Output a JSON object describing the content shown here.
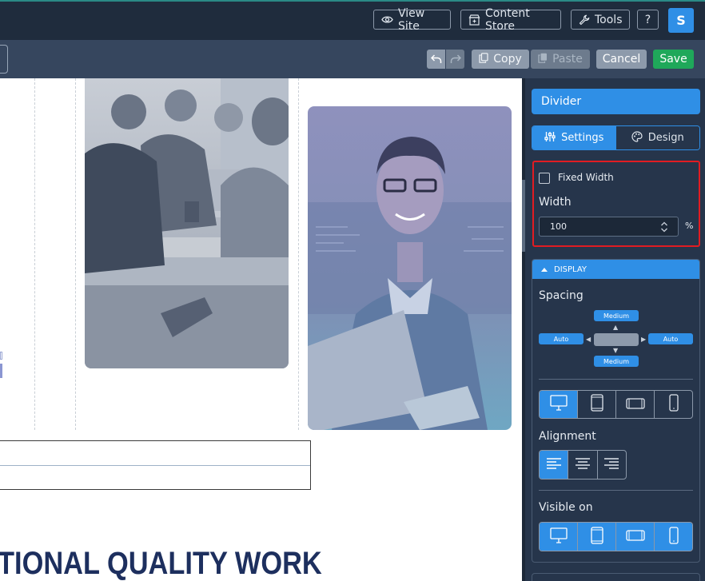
{
  "topbar": {
    "view_site": "View Site",
    "content_store": "Content Store",
    "tools": "Tools",
    "help": "?",
    "avatar": "S",
    "view_site_icon": "eye-icon",
    "content_store_icon": "store-icon",
    "tools_icon": "wrench-icon"
  },
  "toolbar": {
    "undo_icon": "undo-icon",
    "redo_icon": "redo-icon",
    "copy": "Copy",
    "paste": "Paste",
    "cancel": "Cancel",
    "save": "Save"
  },
  "canvas": {
    "heading": "TIONAL QUALITY WORK"
  },
  "panel": {
    "title": "Divider",
    "tabs": [
      {
        "label": "Settings",
        "icon": "sliders-icon",
        "active": true
      },
      {
        "label": "Design",
        "icon": "palette-icon",
        "active": false
      }
    ],
    "fixed_width": {
      "label": "Fixed Width",
      "checked": false
    },
    "width": {
      "label": "Width",
      "value": "100",
      "unit": "%"
    },
    "display": {
      "header": "DISPLAY",
      "spacing": {
        "label": "Spacing",
        "top": "Medium",
        "left": "Auto",
        "right": "Auto",
        "bottom": "Medium"
      },
      "devices": [
        "desktop-icon",
        "tablet-icon",
        "tablet-landscape-icon",
        "phone-icon"
      ],
      "alignment": {
        "label": "Alignment",
        "options": [
          "align-left-icon",
          "align-center-icon",
          "align-right-icon"
        ],
        "selected": "align-left-icon"
      },
      "visible_on": {
        "label": "Visible on",
        "devices": [
          "desktop-icon",
          "tablet-icon",
          "tablet-landscape-icon",
          "phone-icon"
        ]
      }
    }
  },
  "colors": {
    "topbar": "#1f2c3d",
    "secbar": "#36465e",
    "panel": "#26354b",
    "accent": "#2f8fe6",
    "save": "#1fa85a",
    "highlight": "#e11c22",
    "heading": "#1d2f5e"
  }
}
